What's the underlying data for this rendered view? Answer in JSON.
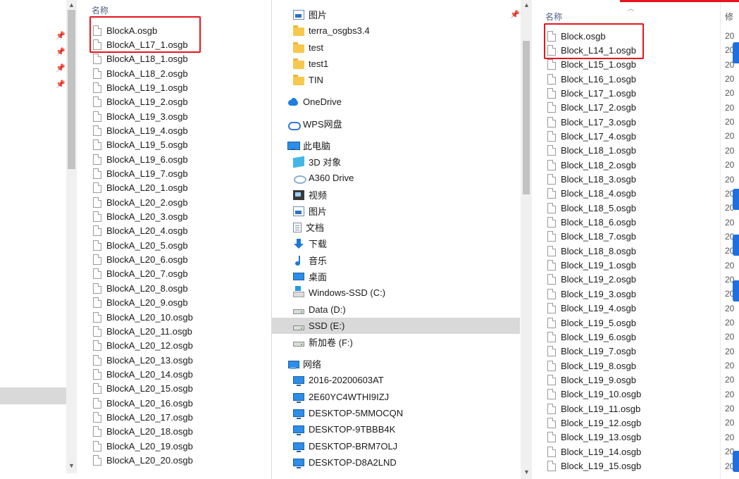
{
  "left_panel": {
    "header": "名称",
    "files": [
      "BlockA.osgb",
      "BlockA_L17_1.osgb",
      "BlockA_L18_1.osgb",
      "BlockA_L18_2.osgb",
      "BlockA_L19_1.osgb",
      "BlockA_L19_2.osgb",
      "BlockA_L19_3.osgb",
      "BlockA_L19_4.osgb",
      "BlockA_L19_5.osgb",
      "BlockA_L19_6.osgb",
      "BlockA_L19_7.osgb",
      "BlockA_L20_1.osgb",
      "BlockA_L20_2.osgb",
      "BlockA_L20_3.osgb",
      "BlockA_L20_4.osgb",
      "BlockA_L20_5.osgb",
      "BlockA_L20_6.osgb",
      "BlockA_L20_7.osgb",
      "BlockA_L20_8.osgb",
      "BlockA_L20_9.osgb",
      "BlockA_L20_10.osgb",
      "BlockA_L20_11.osgb",
      "BlockA_L20_12.osgb",
      "BlockA_L20_13.osgb",
      "BlockA_L20_14.osgb",
      "BlockA_L20_15.osgb",
      "BlockA_L20_16.osgb",
      "BlockA_L20_17.osgb",
      "BlockA_L20_18.osgb",
      "BlockA_L20_19.osgb",
      "BlockA_L20_20.osgb"
    ]
  },
  "nav_pane": {
    "items": [
      {
        "label": "图片",
        "icon": "pictures-icon"
      },
      {
        "label": "terra_osgbs3.4",
        "icon": "folder-icon"
      },
      {
        "label": "test",
        "icon": "folder-icon"
      },
      {
        "label": "test1",
        "icon": "folder-icon"
      },
      {
        "label": "TIN",
        "icon": "folder-icon"
      },
      {
        "label": "OneDrive",
        "icon": "onedrive-icon"
      },
      {
        "label": "WPS网盘",
        "icon": "wps-cloud-icon"
      },
      {
        "label": "此电脑",
        "icon": "this-pc-icon"
      },
      {
        "label": "3D 对象",
        "icon": "3d-objects-icon"
      },
      {
        "label": "A360 Drive",
        "icon": "a360-drive-icon"
      },
      {
        "label": "视频",
        "icon": "videos-icon"
      },
      {
        "label": "图片",
        "icon": "pictures-icon"
      },
      {
        "label": "文档",
        "icon": "documents-icon"
      },
      {
        "label": "下载",
        "icon": "downloads-icon"
      },
      {
        "label": "音乐",
        "icon": "music-icon"
      },
      {
        "label": "桌面",
        "icon": "desktop-icon"
      },
      {
        "label": "Windows-SSD (C:)",
        "icon": "windows-drive-icon"
      },
      {
        "label": "Data (D:)",
        "icon": "drive-icon"
      },
      {
        "label": "SSD (E:)",
        "icon": "drive-icon",
        "selected": true
      },
      {
        "label": "新加卷 (F:)",
        "icon": "drive-icon"
      },
      {
        "label": "网络",
        "icon": "network-icon"
      },
      {
        "label": "2016-20200603AT",
        "icon": "computer-icon"
      },
      {
        "label": "2E60YC4WTHI9IZJ",
        "icon": "computer-icon"
      },
      {
        "label": "DESKTOP-5MMOCQN",
        "icon": "computer-icon"
      },
      {
        "label": "DESKTOP-9TBBB4K",
        "icon": "computer-icon"
      },
      {
        "label": "DESKTOP-BRM7OLJ",
        "icon": "computer-icon"
      },
      {
        "label": "DESKTOP-D8A2LND",
        "icon": "computer-icon"
      }
    ]
  },
  "right_panel": {
    "header": "名称",
    "date_header": "修",
    "date_prefix": "20",
    "files": [
      "Block.osgb",
      "Block_L14_1.osgb",
      "Block_L15_1.osgb",
      "Block_L16_1.osgb",
      "Block_L17_1.osgb",
      "Block_L17_2.osgb",
      "Block_L17_3.osgb",
      "Block_L17_4.osgb",
      "Block_L18_1.osgb",
      "Block_L18_2.osgb",
      "Block_L18_3.osgb",
      "Block_L18_4.osgb",
      "Block_L18_5.osgb",
      "Block_L18_6.osgb",
      "Block_L18_7.osgb",
      "Block_L18_8.osgb",
      "Block_L19_1.osgb",
      "Block_L19_2.osgb",
      "Block_L19_3.osgb",
      "Block_L19_4.osgb",
      "Block_L19_5.osgb",
      "Block_L19_6.osgb",
      "Block_L19_7.osgb",
      "Block_L19_8.osgb",
      "Block_L19_9.osgb",
      "Block_L19_10.osgb",
      "Block_L19_11.osgb",
      "Block_L19_12.osgb",
      "Block_L19_13.osgb",
      "Block_L19_14.osgb",
      "Block_L19_15.osgb"
    ]
  },
  "colors": {
    "highlight_box": "#e8141d",
    "selection": "#d9d9d9",
    "accent_blue": "#1f6fe0"
  }
}
